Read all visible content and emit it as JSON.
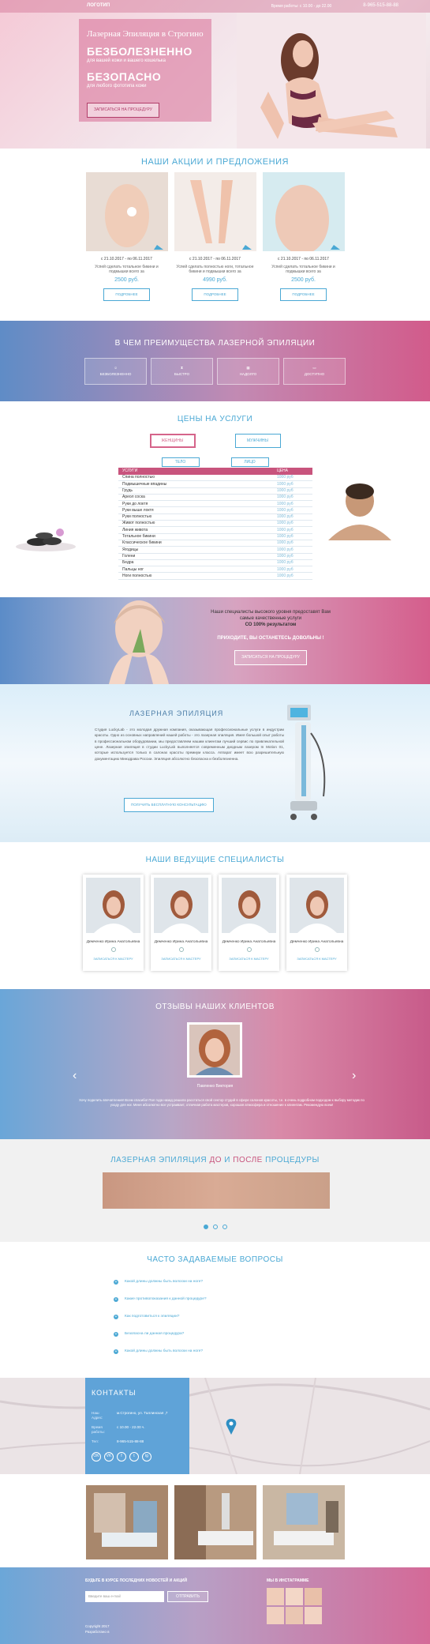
{
  "header": {
    "logo": "ЛОГОТИП",
    "hours": "Время работы: с 10.00 - до 22.00",
    "phone": "8-965-515-88-88"
  },
  "hero": {
    "title": "Лазерная Эпиляция в Строгино",
    "h1": "БЕЗБОЛЕЗНЕННО",
    "s1": "для вашей кожи и вашего кошелька",
    "h2": "БЕЗОПАСНО",
    "s2": "для любого фототипа кожи",
    "cta": "ЗАПИСАТЬСЯ НА ПРОЦЕДУРУ"
  },
  "promos": {
    "title": "НАШИ АКЦИИ И ПРЕДЛОЖЕНИЯ",
    "cards": [
      {
        "date": "с 21.10.2017 - по 06.11.2017",
        "desc": "Успей сделать тотальное бикини и подмышки всего за",
        "price": "2500 руб.",
        "btn": "ПОДРОБНЕЕ"
      },
      {
        "date": "с 21.10.2017 - по 06.11.2017",
        "desc": "Успей сделать полностью ноги, тотальное бикини и подмышки всего за",
        "price": "4990 руб.",
        "btn": "ПОДРОБНЕЕ"
      },
      {
        "date": "с 21.10.2017 - по 06.11.2017",
        "desc": "Успей сделать тотальное бикини и подмышки всего за",
        "price": "2500 руб.",
        "btn": "ПОДРОБНЕЕ"
      }
    ]
  },
  "advantages": {
    "title": "В ЧЕМ ПРЕИМУЩЕСТВА ЛАЗЕРНОЙ ЭПИЛЯЦИИ",
    "items": [
      {
        "label": "БЕЗБОЛЕЗНЕННО",
        "icon": "smile-icon"
      },
      {
        "label": "БЫСТРО",
        "icon": "hourglass-icon"
      },
      {
        "label": "НАДОЛГО",
        "icon": "calendar-icon"
      },
      {
        "label": "ДОСТУПНО",
        "icon": "wallet-icon"
      }
    ]
  },
  "prices": {
    "title": "ЦЕНЫ НА УСЛУГИ",
    "gender_tabs": [
      "ЖЕНЩИНЫ",
      "МУЖЧИНЫ"
    ],
    "zone_tabs": [
      "ТЕЛО",
      "ЛИЦО"
    ],
    "col_service": "УСЛУГИ",
    "col_price": "ЦЕНА",
    "rows": [
      {
        "s": "Спина полностью",
        "p": "1000 руб"
      },
      {
        "s": "Подмышечные впадины",
        "p": "1000 руб"
      },
      {
        "s": "Грудь",
        "p": "1000 руб"
      },
      {
        "s": "Ареол соска",
        "p": "1000 руб"
      },
      {
        "s": "Руки до локтя",
        "p": "1000 руб"
      },
      {
        "s": "Руки выше локтя",
        "p": "1000 руб"
      },
      {
        "s": "Руки полностью",
        "p": "1000 руб"
      },
      {
        "s": "Живот полностью",
        "p": "1000 руб"
      },
      {
        "s": "Линия живота",
        "p": "1000 руб"
      },
      {
        "s": "Тотальное бикини",
        "p": "1000 руб"
      },
      {
        "s": "Классическое бикини",
        "p": "1000 руб"
      },
      {
        "s": "Ягодицы",
        "p": "1000 руб"
      },
      {
        "s": "Голени",
        "p": "1000 руб"
      },
      {
        "s": "Бедра",
        "p": "1000 руб"
      },
      {
        "s": "Пальцы ног",
        "p": "1000 руб"
      },
      {
        "s": "Ноги полностью",
        "p": "1000 руб"
      }
    ]
  },
  "promo_banner": {
    "line1": "Наши специалисты высокого уровня предоставят Вам самые качественные услуги",
    "line2": "СО 100% результатом",
    "line3": "ПРИХОДИТЕ, ВЫ ОСТАНЕТЕСЬ ДОВОЛЬНЫ !",
    "cta": "ЗАПИСАТЬСЯ НА ПРОЦЕДУРУ"
  },
  "about": {
    "title": "ЛАЗЕРНАЯ ЭПИЛЯЦИЯ",
    "text": "Студия LuckyLab - это молодая дружная компания, оказывающая профессиональные услуги в индустрии красоты. Одно из основных направлений нашей работы - это лазерная эпиляция. Имея большой опыт работы в профессиональном оборудовании, мы предоставляем нашим клиентам лучший сервис по привлекательной цене. Лазерная эпиляция в студии LuckyLab выполняется современным диодным лазером In Motion 01, которые используется только в салонах красоты премиум класса. Аппарат имеет всю разрешительную документацию Минздрава России. Эпиляция абсолютно безопасна и безболезненна.",
    "cta": "ПОЛУЧИТЬ БЕСПЛАТНУЮ КОНСУЛЬТАЦИЮ"
  },
  "specialists": {
    "title": "НАШИ ВЕДУЩИЕ СПЕЦИАЛИСТЫ",
    "cards": [
      {
        "name": "Демченко Ирина Анатольевна",
        "link": "ЗАПИСАТЬСЯ К МАСТЕРУ"
      },
      {
        "name": "Демченко Ирина Анатольевна",
        "link": "ЗАПИСАТЬСЯ К МАСТЕРУ"
      },
      {
        "name": "Демченко Ирина Анатольевна",
        "link": "ЗАПИСАТЬСЯ К МАСТЕРУ"
      },
      {
        "name": "Демченко Ирина Анатольевна",
        "link": "ЗАПИСАТЬСЯ К МАСТЕРУ"
      }
    ]
  },
  "reviews": {
    "title": "ОТЗЫВЫ НАШИХ КЛИЕНТОВ",
    "name": "Павленко Виктория",
    "text": "Хочу поделить впечатления! Всем спасибо! Пол года назад решила расстаться свой сектор студий в сфере салонов красоты, т.е. в очень подробном подходом к выбору методик по уходу для ног. Меня абсолютно все устраивает, отличная работа мастеров, хорошая атмосфера и отношение к клиентам. Рекомендую всем!"
  },
  "before_after": {
    "t1": "ЛАЗЕРНАЯ ЭПИЛЯЦИЯ",
    "t2": "ДО",
    "t3": "И",
    "t4": "ПОСЛЕ",
    "t5": "ПРОЦЕДУРЫ"
  },
  "faq": {
    "title": "ЧАСТО ЗАДАВАЕМЫЕ ВОПРОСЫ",
    "items": [
      "Какой длины должны быть волоски на ноге?",
      "Какие противопоказания к данной процедуре?",
      "Как подготовиться к эпиляции?",
      "Безопасна ли данная процедура?",
      "Какой длины должны быть волоски на ноге?"
    ]
  },
  "contacts": {
    "title": "КОНТАКТЫ",
    "addr_k": "Наш Адрес:",
    "addr_v": "м.Строгино, ул. Таллинская ,7",
    "time_k": "Время работы:",
    "time_v": "с 10.00 - 22.00 ч.",
    "tel_k": "Тел:",
    "tel_v": "8-965-515-88-88",
    "social": [
      "OK",
      "VK",
      "f",
      "t",
      "ig"
    ]
  },
  "footer": {
    "subscribe": "БУДЬТЕ В КУРСЕ ПОСЛЕДНИХ НОВОСТЕЙ И АКЦИЙ",
    "placeholder": "Введите ваш e-mail",
    "send": "ОТПРАВИТЬ",
    "instagram": "МЫ В ИНСТАГРАММЕ",
    "copyright": "Copyright 2017",
    "dev": "Разработано в"
  },
  "colors": {
    "accent_blue": "#4aa8d4",
    "accent_pink": "#c8547d"
  }
}
